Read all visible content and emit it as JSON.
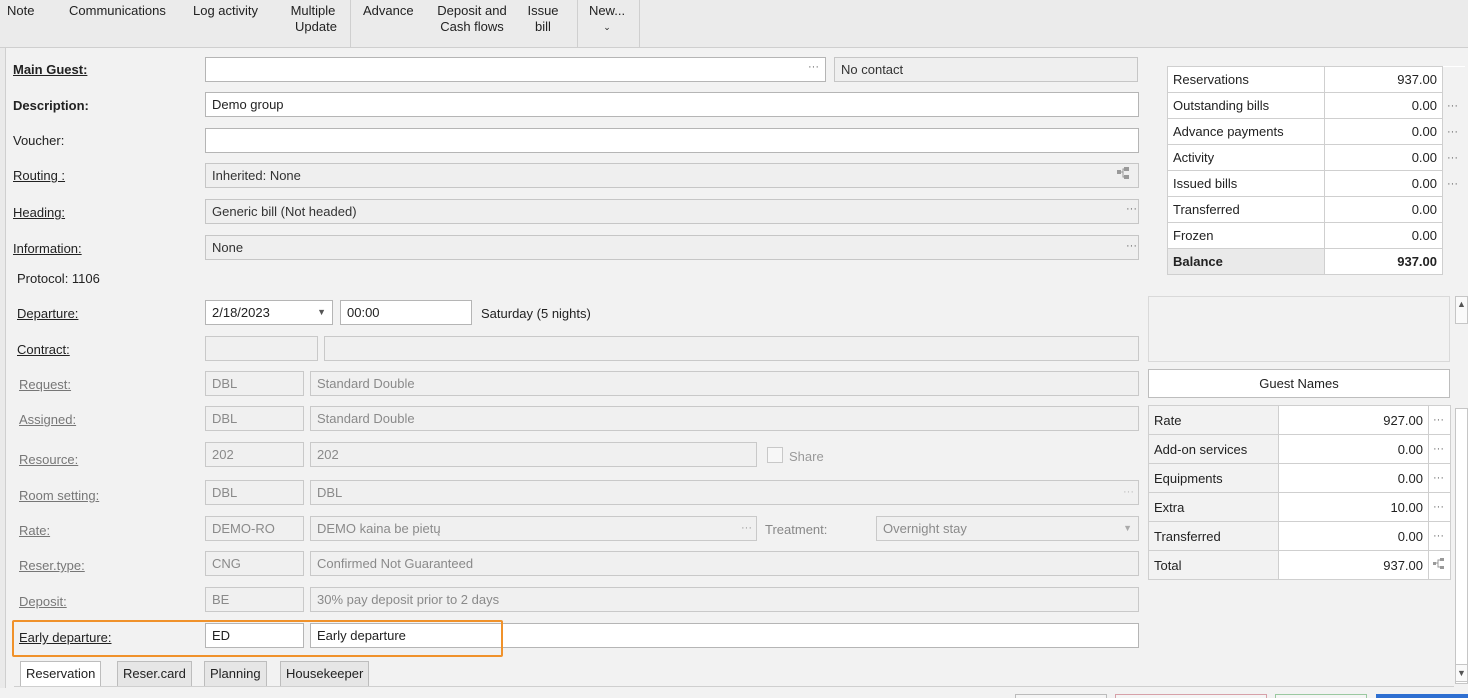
{
  "toolbar": {
    "note": "Note",
    "communications": "Communications",
    "log_activity": "Log activity",
    "multiple_update_1": "Multiple",
    "multiple_update_2": "Update",
    "advance": "Advance",
    "deposit_1": "Deposit and",
    "deposit_2": "Cash flows",
    "issue_1": "Issue",
    "issue_2": "bill",
    "new": "New..."
  },
  "main_guest": {
    "label": "Main Guest:",
    "value": "",
    "contact": "No contact"
  },
  "description": {
    "label": "Description:",
    "value": "Demo group"
  },
  "voucher": {
    "label": "Voucher:",
    "value": ""
  },
  "routing": {
    "label": "Routing :",
    "value": "Inherited: None"
  },
  "heading": {
    "label": "Heading:",
    "value": "Generic bill (Not headed)"
  },
  "information": {
    "label": "Information:",
    "value": "None"
  },
  "protocol": "Protocol: 1106",
  "departure": {
    "label": "Departure:",
    "date": "2/18/2023",
    "time": "00:00",
    "note": "Saturday (5 nights)"
  },
  "contract": {
    "label": "Contract:",
    "code": "",
    "name": ""
  },
  "request": {
    "label": "Request:",
    "code": "DBL",
    "name": "Standard Double"
  },
  "assigned": {
    "label": "Assigned:",
    "code": "DBL",
    "name": "Standard Double"
  },
  "resource": {
    "label": "Resource:",
    "code": "202",
    "name": "202",
    "share": "Share"
  },
  "room_setting": {
    "label": "Room setting:",
    "code": "DBL",
    "name": "DBL"
  },
  "rate": {
    "label": "Rate:",
    "code": "DEMO-RO",
    "name": "DEMO kaina be pietų",
    "treatment_label": "Treatment:",
    "treatment": "Overnight stay"
  },
  "reser_type": {
    "label": "Reser.type:",
    "code": "CNG",
    "name": "Confirmed Not Guaranteed"
  },
  "deposit": {
    "label": "Deposit:",
    "code": "BE",
    "name": "30% pay deposit prior to 2 days"
  },
  "early_departure": {
    "label": "Early departure:",
    "code": "ED",
    "name": "Early departure"
  },
  "summary": [
    {
      "label": "Reservations",
      "value": "937.00",
      "dots": ""
    },
    {
      "label": "Outstanding bills",
      "value": "0.00",
      "dots": "···"
    },
    {
      "label": "Advance payments",
      "value": "0.00",
      "dots": "···"
    },
    {
      "label": "Activity",
      "value": "0.00",
      "dots": "···"
    },
    {
      "label": "Issued bills",
      "value": "0.00",
      "dots": "···"
    },
    {
      "label": "Transferred",
      "value": "0.00",
      "dots": ""
    },
    {
      "label": "Frozen",
      "value": "0.00",
      "dots": ""
    },
    {
      "label": "Balance",
      "value": "937.00",
      "dots": ""
    }
  ],
  "guest_names_button": "Guest Names",
  "rates": [
    {
      "label": "Rate",
      "value": "927.00"
    },
    {
      "label": "Add-on services",
      "value": "0.00"
    },
    {
      "label": "Equipments",
      "value": "0.00"
    },
    {
      "label": "Extra",
      "value": "10.00"
    },
    {
      "label": "Transferred",
      "value": "0.00"
    },
    {
      "label": "Total",
      "value": "937.00"
    }
  ],
  "tabs": [
    "Reservation",
    "Reser.card",
    "Planning",
    "Housekeeper"
  ],
  "colors": {
    "highlight": "#f0922b"
  }
}
